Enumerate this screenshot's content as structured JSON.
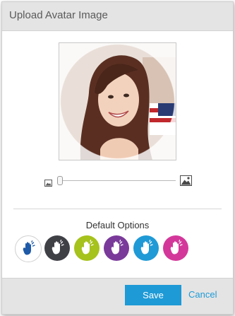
{
  "dialog": {
    "title": "Upload Avatar Image"
  },
  "cropper": {
    "zoom_level": 0,
    "zoom_out_icon": "image-icon",
    "zoom_in_icon": "image-icon"
  },
  "default_options": {
    "title": "Default Options",
    "icon": "hand-icon",
    "options": [
      {
        "bg": "#ffffff",
        "fg": "#1e5aa8",
        "bordered": true
      },
      {
        "bg": "#3f3f46",
        "fg": "#ffffff"
      },
      {
        "bg": "#a6c21c",
        "fg": "#ffffff"
      },
      {
        "bg": "#7a3a9a",
        "fg": "#ffffff"
      },
      {
        "bg": "#1f9ad6",
        "fg": "#ffffff"
      },
      {
        "bg": "#d4379a",
        "fg": "#ffffff"
      }
    ]
  },
  "footer": {
    "save_label": "Save",
    "cancel_label": "Cancel"
  },
  "colors": {
    "accent": "#1e9ad6",
    "header_bg": "#e4e4e4"
  }
}
